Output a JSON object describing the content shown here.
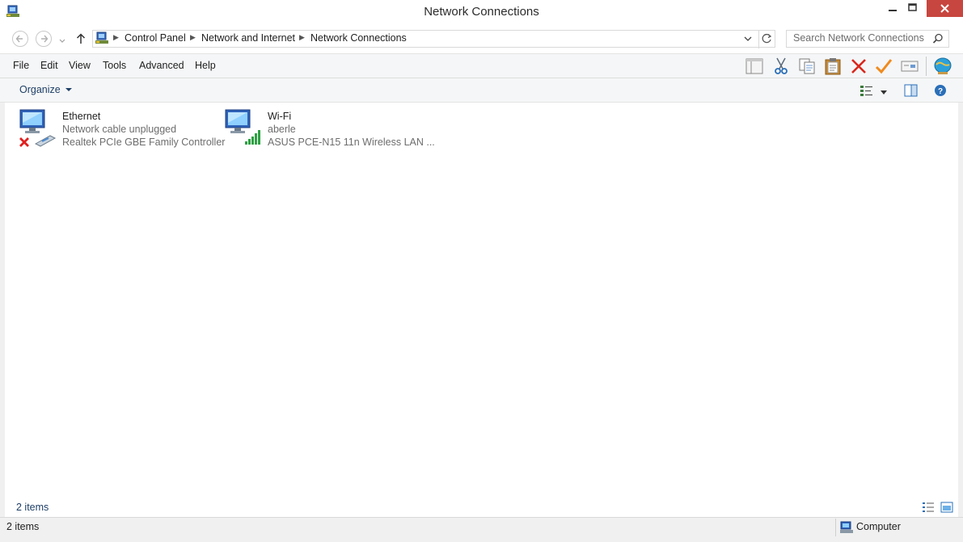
{
  "window": {
    "title": "Network Connections"
  },
  "address": {
    "crumbs": [
      "Control Panel",
      "Network and Internet",
      "Network Connections"
    ]
  },
  "search": {
    "placeholder": "Search Network Connections"
  },
  "menu": {
    "items": [
      "File",
      "Edit",
      "View",
      "Tools",
      "Advanced",
      "Help"
    ]
  },
  "toolbar": {
    "icons": [
      "layout-icon",
      "cut-icon",
      "copy-icon",
      "paste-icon",
      "delete-icon",
      "undo-check-icon",
      "properties-icon",
      "network-globe-icon"
    ]
  },
  "command_bar": {
    "organize_label": "Organize"
  },
  "connections": [
    {
      "name": "Ethernet",
      "status": "Network cable unplugged",
      "device": "Realtek PCIe GBE Family Controller"
    },
    {
      "name": "Wi-Fi",
      "status": "aberle",
      "device": "ASUS PCE-N15 11n Wireless LAN ..."
    }
  ],
  "content": {
    "items_count": "2 items"
  },
  "statusbar": {
    "items_count": "2 items",
    "zone_label": "Computer"
  },
  "colors": {
    "accent": "#1e3f66",
    "close_red": "#c7463f",
    "error_red": "#e02020",
    "signal_green": "#2ea043"
  }
}
